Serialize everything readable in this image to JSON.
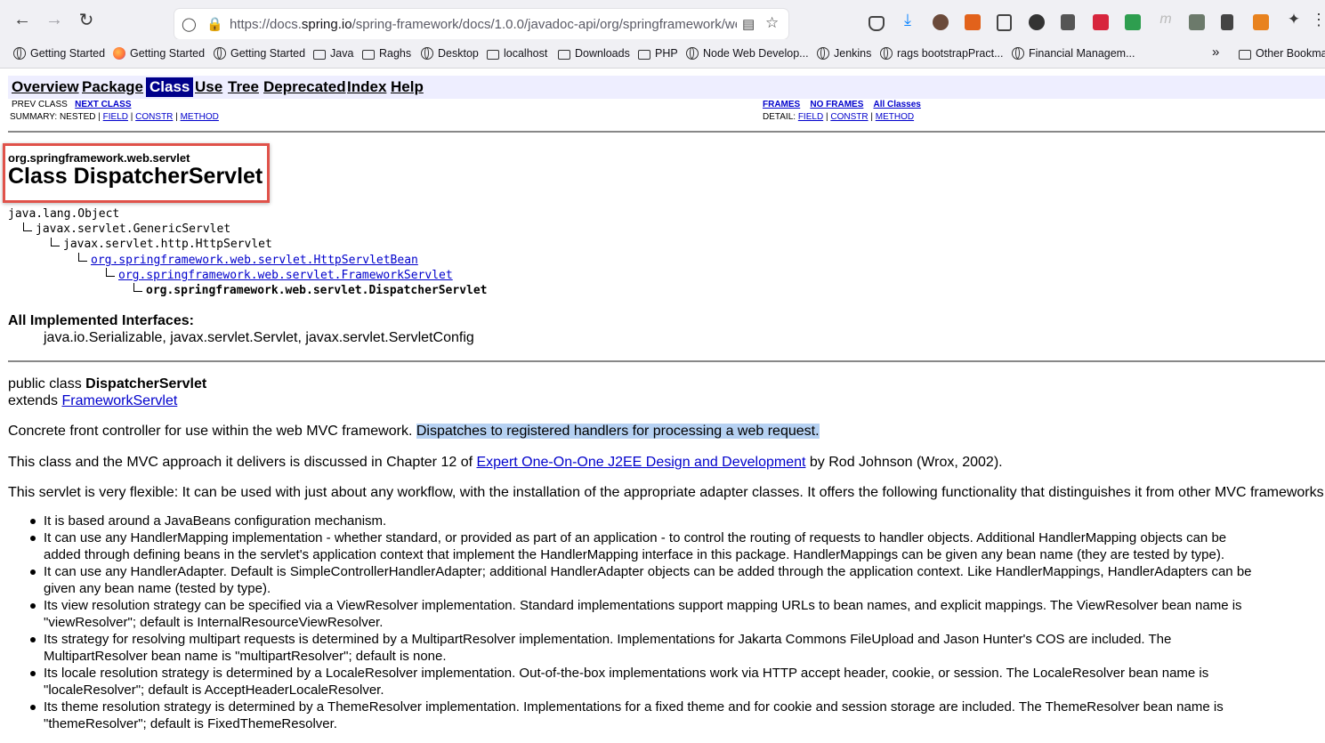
{
  "browser": {
    "url_prefix": "https://docs.",
    "url_domain": "spring.io",
    "url_suffix": "/spring-framework/docs/1.0.0/javadoc-api/org/springframework/we",
    "bookmarks": [
      {
        "label": "Getting Started",
        "icon": "globe"
      },
      {
        "label": "Getting Started",
        "icon": "firefox"
      },
      {
        "label": "Getting Started",
        "icon": "globe"
      },
      {
        "label": "Java",
        "icon": "folder"
      },
      {
        "label": "Raghs",
        "icon": "folder"
      },
      {
        "label": "Desktop",
        "icon": "globe"
      },
      {
        "label": "localhost",
        "icon": "folder"
      },
      {
        "label": "Downloads",
        "icon": "folder"
      },
      {
        "label": "PHP",
        "icon": "folder"
      },
      {
        "label": "Node Web Develop...",
        "icon": "globe"
      },
      {
        "label": "Jenkins",
        "icon": "globe"
      },
      {
        "label": "rags bootstrapPract...",
        "icon": "globe"
      },
      {
        "label": "Financial Managem...",
        "icon": "globe"
      }
    ],
    "other_bookmarks": "Other Bookmar"
  },
  "nav": {
    "overview": "Overview",
    "package": "Package",
    "class": "Class",
    "use": "Use",
    "tree": "Tree",
    "deprecated": "Deprecated",
    "index": "Index",
    "help": "Help",
    "prev_class": "PREV CLASS",
    "next_class": "NEXT CLASS",
    "frames": "FRAMES",
    "no_frames": "NO FRAMES",
    "all_classes": "All Classes",
    "summary_label": "SUMMARY: NESTED |",
    "detail_label": "DETAIL:",
    "field": "FIELD",
    "constr": "CONSTR",
    "method": "METHOD",
    "sep": "|"
  },
  "header": {
    "package": "org.springframework.web.servlet",
    "title": "Class DispatcherServlet"
  },
  "hierarchy": {
    "l0": "java.lang.Object",
    "l1": "javax.servlet.GenericServlet",
    "l2": "javax.servlet.http.HttpServlet",
    "l3": "org.springframework.web.servlet.HttpServletBean",
    "l4": "org.springframework.web.servlet.FrameworkServlet",
    "l5": "org.springframework.web.servlet.DispatcherServlet"
  },
  "interfaces": {
    "heading": "All Implemented Interfaces:",
    "list": "java.io.Serializable, javax.servlet.Servlet, javax.servlet.ServletConfig"
  },
  "declaration": {
    "prefix": "public class ",
    "name": "DispatcherServlet",
    "extends": "extends ",
    "parent": "FrameworkServlet"
  },
  "description": {
    "p1_start": "Concrete front controller for use within the web MVC framework. ",
    "p1_highlight": "Dispatches to registered handlers for processing a web request.",
    "p2_start": "This class and the MVC approach it delivers is discussed in Chapter 12 of ",
    "p2_link": "Expert One-On-One J2EE Design and Development",
    "p2_end": " by Rod Johnson (Wrox, 2002).",
    "p3": "This servlet is very flexible: It can be used with just about any workflow, with the installation of the appropriate adapter classes. It offers the following functionality that distinguishes it from other MVC frameworks:"
  },
  "features": [
    [
      "It is based around a JavaBeans configuration mechanism."
    ],
    [
      "It can use any HandlerMapping implementation - whether standard, or provided as part of an application - to control the routing of requests to handler objects. Additional HandlerMapping objects can be",
      "added through defining beans in the servlet's application context that implement the HandlerMapping interface in this package. HandlerMappings can be given any bean name (they are tested by type)."
    ],
    [
      "It can use any HandlerAdapter. Default is SimpleControllerHandlerAdapter; additional HandlerAdapter objects can be added through the application context. Like HandlerMappings, HandlerAdapters can be",
      "given any bean name (tested by type)."
    ],
    [
      "Its view resolution strategy can be specified via a ViewResolver implementation. Standard implementations support mapping URLs to bean names, and explicit mappings. The ViewResolver bean name is",
      "\"viewResolver\"; default is InternalResourceViewResolver."
    ],
    [
      "Its strategy for resolving multipart requests is determined by a MultipartResolver implementation. Implementations for Jakarta Commons FileUpload and Jason Hunter's COS are included. The",
      "MultipartResolver bean name is \"multipartResolver\"; default is none."
    ],
    [
      "Its locale resolution strategy is determined by a LocaleResolver implementation. Out-of-the-box implementations work via HTTP accept header, cookie, or session. The LocaleResolver bean name is",
      "\"localeResolver\"; default is AcceptHeaderLocaleResolver."
    ],
    [
      "Its theme resolution strategy is determined by a ThemeResolver implementation. Implementations for a fixed theme and for cookie and session storage are included. The ThemeResolver bean name is",
      "\"themeResolver\"; default is FixedThemeResolver."
    ]
  ]
}
